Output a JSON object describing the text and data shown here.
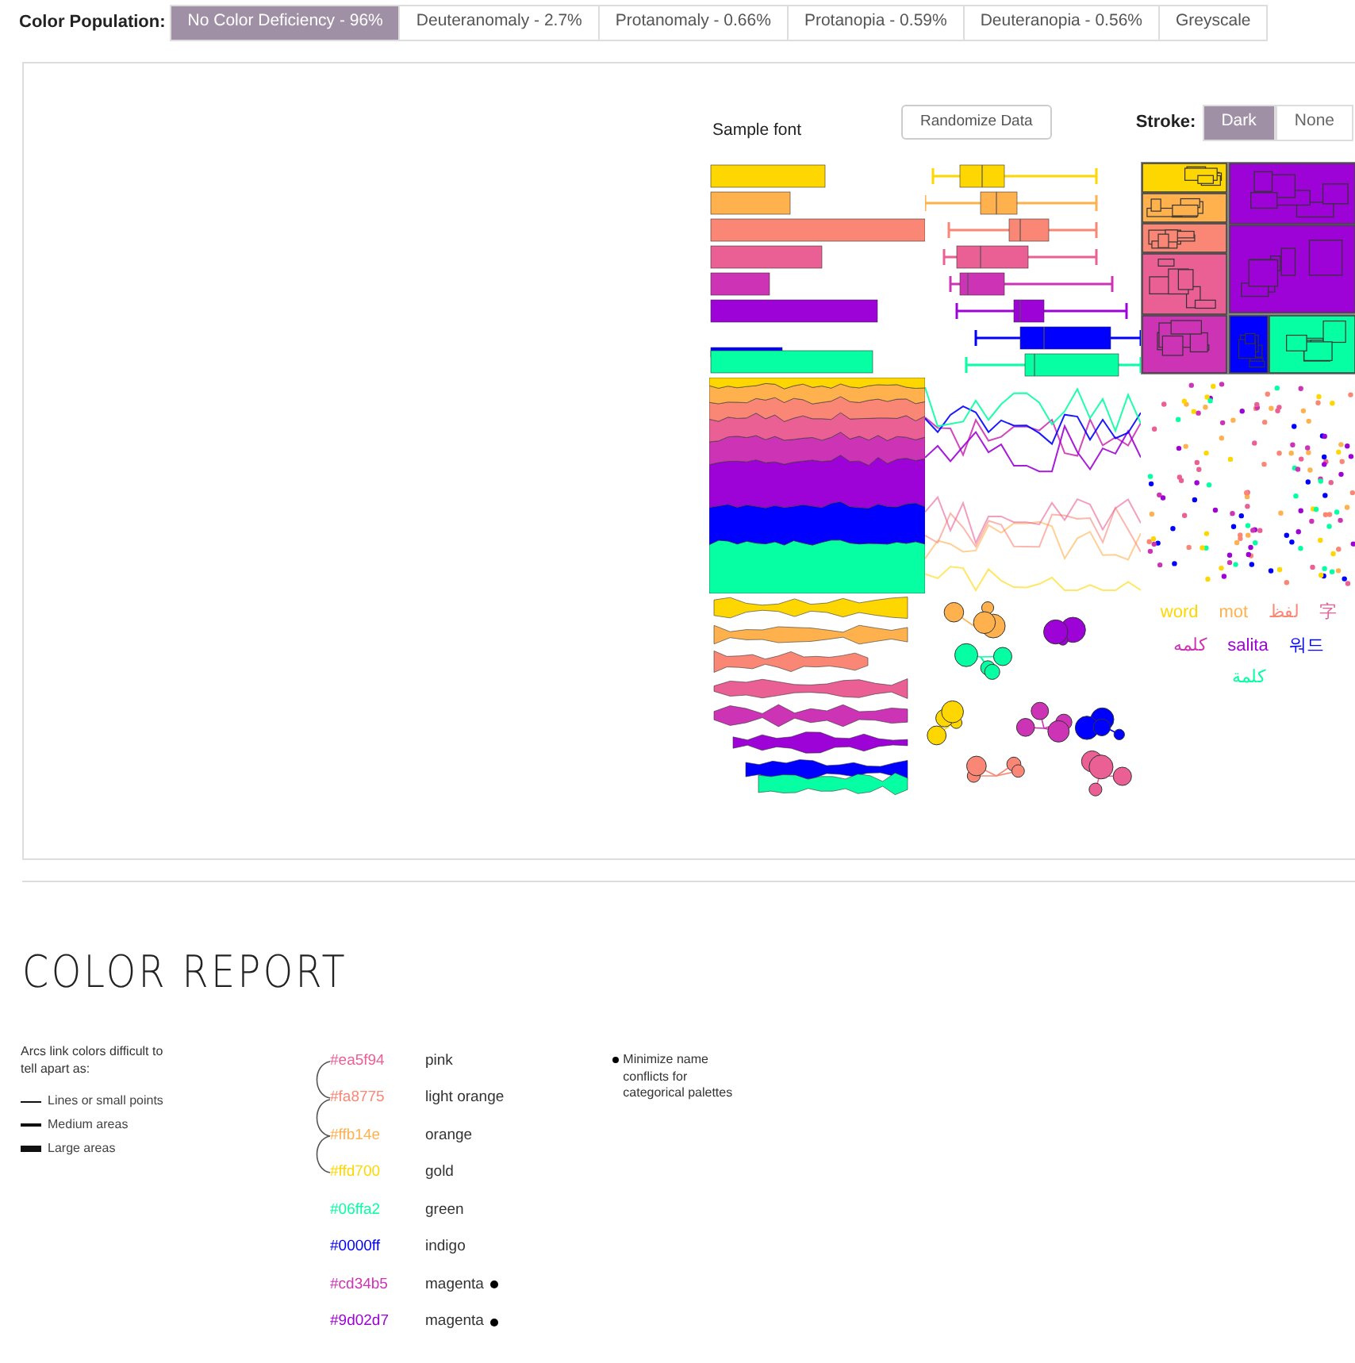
{
  "population": {
    "label": "Color Population:",
    "options": [
      {
        "label": "No Color Deficiency - 96%",
        "selected": true
      },
      {
        "label": "Deuteranomaly - 2.7%",
        "selected": false
      },
      {
        "label": "Protanomaly - 0.66%",
        "selected": false
      },
      {
        "label": "Protanopia - 0.59%",
        "selected": false
      },
      {
        "label": "Deuteranopia - 0.56%",
        "selected": false
      },
      {
        "label": "Greyscale",
        "selected": false
      }
    ]
  },
  "preview": {
    "sample_font": "Sample font",
    "randomize_button": "Randomize Data",
    "stroke": {
      "label": "Stroke:",
      "options": [
        {
          "label": "Dark",
          "selected": true
        },
        {
          "label": "None",
          "selected": false
        }
      ]
    },
    "words": [
      {
        "text": "word",
        "color": "#ffd700"
      },
      {
        "text": "mot",
        "color": "#ffb14e"
      },
      {
        "text": "لفظ",
        "color": "#fa8775"
      },
      {
        "text": "字",
        "color": "#ea5f94"
      },
      {
        "text": "کلمه",
        "color": "#cd34b5"
      },
      {
        "text": "salita",
        "color": "#9d02d7"
      },
      {
        "text": "워드",
        "color": "#0000ff"
      },
      {
        "text": "كلمة",
        "color": "#06ffa2"
      }
    ]
  },
  "report": {
    "title": "COLOR REPORT",
    "legend": {
      "intro": "Arcs link colors difficult to tell apart as:",
      "items": [
        {
          "label": "Lines or small points",
          "kind": "thin"
        },
        {
          "label": "Medium areas",
          "kind": "medium"
        },
        {
          "label": "Large areas",
          "kind": "thick"
        }
      ]
    },
    "palette": [
      {
        "hex": "#ea5f94",
        "name": "pink",
        "color": "#ea5f94",
        "arc_to_next": true,
        "flagged": false
      },
      {
        "hex": "#fa8775",
        "name": "light orange",
        "color": "#fa8775",
        "arc_to_next": true,
        "flagged": false
      },
      {
        "hex": "#ffb14e",
        "name": "orange",
        "color": "#ffb14e",
        "arc_to_next": true,
        "flagged": false
      },
      {
        "hex": "#ffd700",
        "name": "gold",
        "color": "#ffd700",
        "arc_to_next": false,
        "flagged": false
      },
      {
        "hex": "#06ffa2",
        "name": "green",
        "color": "#06ffa2",
        "arc_to_next": false,
        "flagged": false
      },
      {
        "hex": "#0000ff",
        "name": "indigo",
        "color": "#0000ff",
        "arc_to_next": false,
        "flagged": false
      },
      {
        "hex": "#cd34b5",
        "name": "magenta",
        "color": "#cd34b5",
        "arc_to_next": false,
        "flagged": true
      },
      {
        "hex": "#9d02d7",
        "name": "magenta",
        "color": "#9d02d7",
        "arc_to_next": false,
        "flagged": true
      }
    ],
    "note": "Minimize name conflicts for categorical palettes"
  }
}
